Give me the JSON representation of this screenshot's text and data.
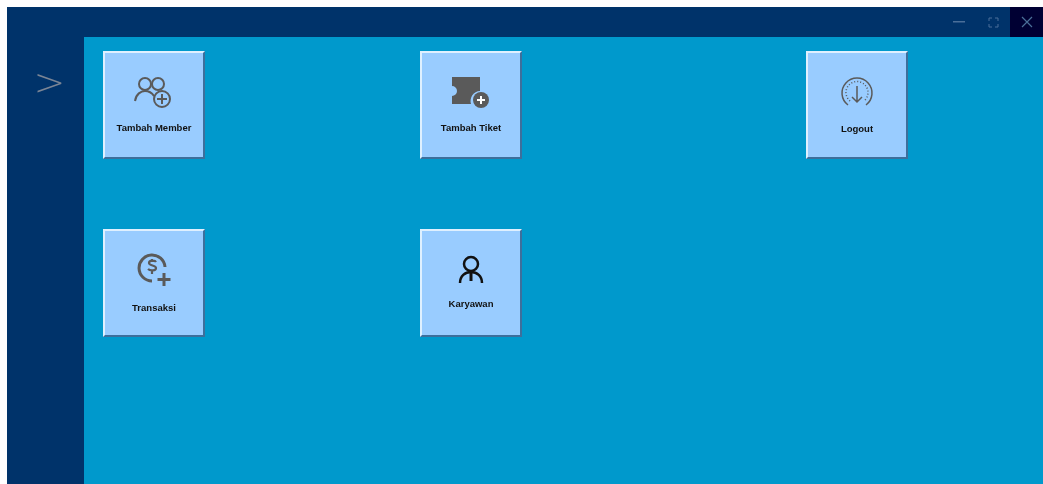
{
  "sidebar": {
    "toggle": ">"
  },
  "tiles": [
    {
      "kind": "member",
      "label": "Tambah Member"
    },
    {
      "kind": "ticket",
      "label": "Tambah Tiket"
    },
    {
      "kind": "logout",
      "label": "Logout"
    },
    {
      "kind": "transaction",
      "label": "Transaksi"
    },
    {
      "kind": "employee",
      "label": "Karyawan"
    }
  ]
}
